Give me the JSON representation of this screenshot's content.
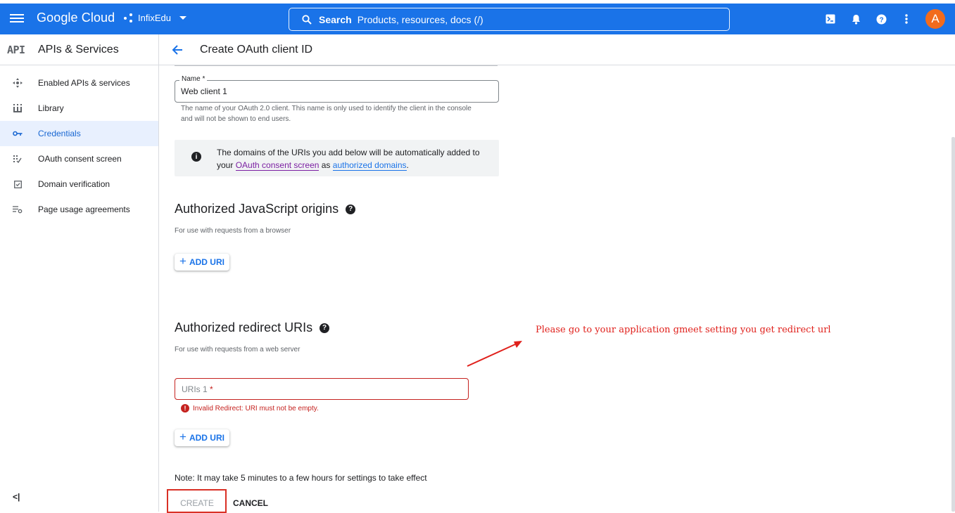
{
  "header": {
    "logo": "Google Cloud",
    "project": "InfixEdu",
    "search_label": "Search",
    "search_placeholder": "Products, resources, docs (/)",
    "avatar_letter": "A",
    "icons": [
      "menu-icon",
      "project-icon",
      "search-icon",
      "terminal-icon",
      "bell-icon",
      "help-icon",
      "more-vert-icon"
    ]
  },
  "subheader": {
    "api_badge": "API",
    "service_title": "APIs & Services",
    "page_title": "Create OAuth client ID"
  },
  "sidebar": {
    "items": [
      {
        "label": "Enabled APIs & services",
        "icon": "apis-icon",
        "active": false
      },
      {
        "label": "Library",
        "icon": "library-icon",
        "active": false
      },
      {
        "label": "Credentials",
        "icon": "key-icon",
        "active": true
      },
      {
        "label": "OAuth consent screen",
        "icon": "consent-icon",
        "active": false
      },
      {
        "label": "Domain verification",
        "icon": "checkbox-icon",
        "active": false
      },
      {
        "label": "Page usage agreements",
        "icon": "settings-list-icon",
        "active": false
      }
    ],
    "collapse_label": "<|"
  },
  "form": {
    "name_label": "Name *",
    "name_value": "Web client 1",
    "name_hint": "The name of your OAuth 2.0 client. This name is only used to identify the client in the console and will not be shown to end users.",
    "info_part1": "The domains of the URIs you add below will be automatically added to your ",
    "info_link1": "OAuth consent screen",
    "info_part2": " as ",
    "info_link2": "authorized domains",
    "info_part3": "."
  },
  "js_origins": {
    "title": "Authorized JavaScript origins",
    "subtitle": "For use with requests from a browser",
    "add_label": "ADD URI"
  },
  "redirect_uris": {
    "title": "Authorized redirect URIs",
    "subtitle": "For use with requests from a web server",
    "field_placeholder": "URIs 1",
    "required_mark": "*",
    "error": "Invalid Redirect: URI must not be empty.",
    "add_label": "ADD URI"
  },
  "footer": {
    "note": "Note: It may take 5 minutes to a few hours for settings to take effect",
    "create_label": "CREATE",
    "cancel_label": "CANCEL"
  },
  "annotation": {
    "text": "Please go to your application gmeet setting you get redirect url",
    "color": "#e0201b"
  },
  "colors": {
    "brand": "#1a73e8",
    "error": "#c5221f",
    "avatar": "#f26b1d"
  }
}
